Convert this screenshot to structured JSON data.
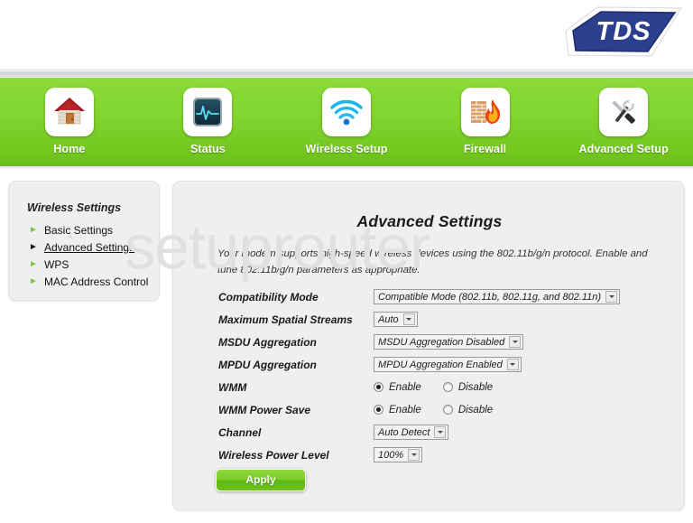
{
  "brand": {
    "logo_text": "TDS"
  },
  "nav": {
    "items": [
      {
        "label": "Home",
        "icon": "house-icon"
      },
      {
        "label": "Status",
        "icon": "pulse-monitor-icon"
      },
      {
        "label": "Wireless Setup",
        "icon": "wifi-signal-icon"
      },
      {
        "label": "Firewall",
        "icon": "firewall-flame-icon"
      },
      {
        "label": "Advanced Setup",
        "icon": "tools-icon"
      }
    ]
  },
  "sidebar": {
    "title": "Wireless Settings",
    "items": [
      {
        "label": "Basic Settings",
        "active": false
      },
      {
        "label": "Advanced Settings",
        "active": true
      },
      {
        "label": "WPS",
        "active": false
      },
      {
        "label": "MAC Address Control",
        "active": false
      }
    ]
  },
  "main": {
    "title": "Advanced Settings",
    "intro": "Your modem supports high-speed wireless devices using the 802.11b/g/n protocol. Enable and tune 802.11b/g/n parameters as appropriate.",
    "fields": [
      {
        "label": "Compatibility Mode",
        "type": "select",
        "value": "Compatible Mode (802.11b, 802.11g, and 802.11n)"
      },
      {
        "label": "Maximum Spatial Streams",
        "type": "select",
        "value": "Auto"
      },
      {
        "label": "MSDU Aggregation",
        "type": "select",
        "value": "MSDU Aggregation Disabled"
      },
      {
        "label": "MPDU Aggregation",
        "type": "select",
        "value": "MPDU Aggregation Enabled"
      },
      {
        "label": "WMM",
        "type": "radio",
        "options": [
          {
            "label": "Enable",
            "selected": true
          },
          {
            "label": "Disable",
            "selected": false
          }
        ]
      },
      {
        "label": "WMM Power Save",
        "type": "radio",
        "options": [
          {
            "label": "Enable",
            "selected": true
          },
          {
            "label": "Disable",
            "selected": false
          }
        ]
      },
      {
        "label": "Channel",
        "type": "select",
        "value": "Auto Detect"
      },
      {
        "label": "Wireless Power Level",
        "type": "select",
        "value": "100%"
      }
    ],
    "apply_label": "Apply"
  },
  "watermark": {
    "text": "setuprouter"
  },
  "colors": {
    "nav_green_top": "#8ada3a",
    "nav_green_bottom": "#6cbf19",
    "panel_bg": "#efefef",
    "brand_blue": "#2c3f8f",
    "accent_green": "#7ac943"
  }
}
